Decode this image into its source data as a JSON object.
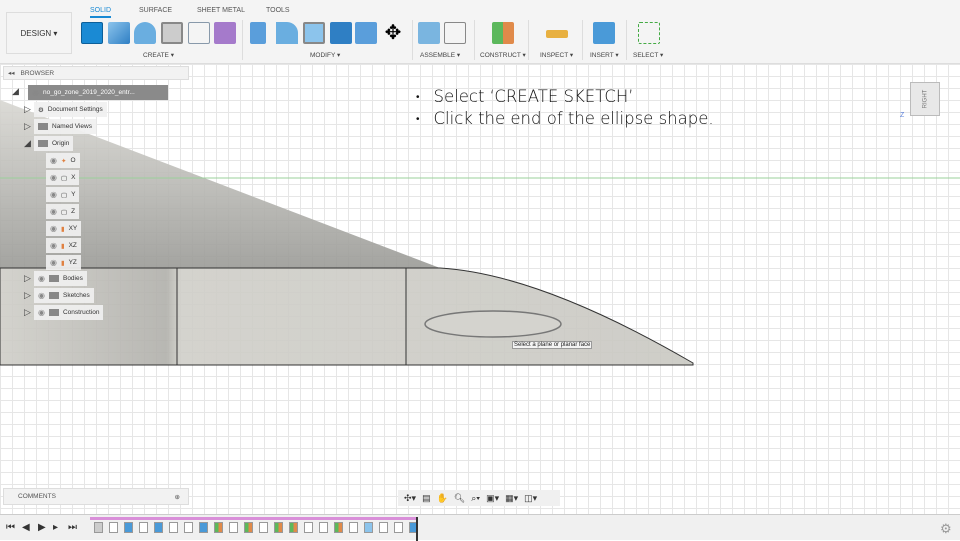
{
  "toolbar": {
    "design_label": "DESIGN ▾",
    "tabs": [
      "SOLID",
      "SURFACE",
      "SHEET METAL",
      "TOOLS"
    ],
    "groups": [
      "CREATE ▾",
      "MODIFY ▾",
      "ASSEMBLE ▾",
      "CONSTRUCT ▾",
      "INSPECT ▾",
      "INSERT ▾",
      "SELECT ▾"
    ]
  },
  "browser": {
    "title": "BROWSER",
    "root": "no_go_zone_2019_2020_entr...",
    "items": [
      "Document Settings",
      "Named Views",
      "Origin",
      "O",
      "X",
      "Y",
      "Z",
      "XY",
      "XZ",
      "YZ",
      "Bodies",
      "Sketches",
      "Construction"
    ]
  },
  "instructions": [
    "Select ‘CREATE SKETCH’",
    "Click the end of the ellipse shape."
  ],
  "tooltip": "Select a plane or planar face",
  "viewcube": {
    "face": "RIGHT",
    "axis": "Z"
  },
  "comments": {
    "title": "COMMENTS"
  },
  "timeline": {
    "items": [
      "component",
      "sketch",
      "extrude",
      "sketch",
      "extrude",
      "sketch",
      "sketch",
      "extrude",
      "plane",
      "sketch",
      "plane",
      "sketch",
      "plane",
      "plane",
      "sketch",
      "sketch",
      "plane",
      "sketch",
      "shell",
      "sketch",
      "sketch",
      "extrude"
    ]
  },
  "colors": {
    "accent": "#1a8ad4",
    "timeline_bar": "#d98fd9",
    "body": "#c9c8c2"
  }
}
